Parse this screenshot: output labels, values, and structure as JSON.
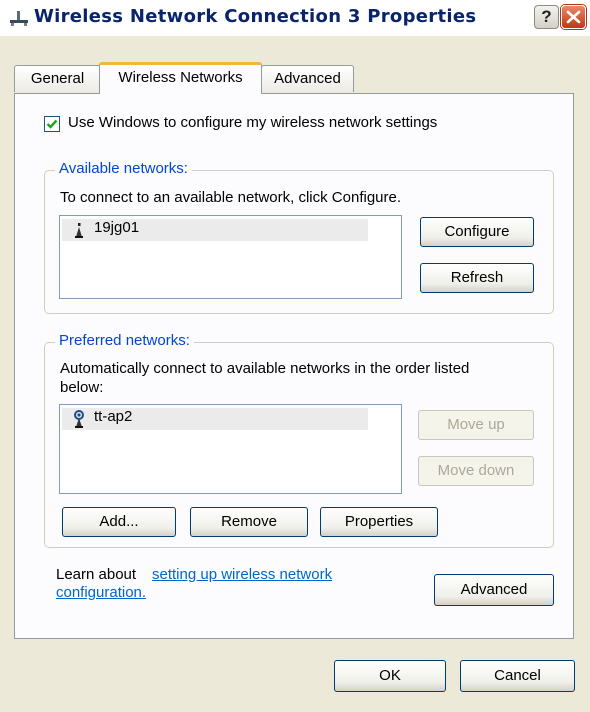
{
  "window": {
    "title": "Wireless Network Connection 3 Properties",
    "help_label": "?",
    "close_label": "Close"
  },
  "tabs": [
    {
      "label": "General",
      "active": false
    },
    {
      "label": "Wireless Networks",
      "active": true
    },
    {
      "label": "Advanced",
      "active": false
    }
  ],
  "use_windows": {
    "label": "Use Windows to configure my wireless network settings",
    "checked": true
  },
  "available": {
    "group_title": "Available networks:",
    "instruction": "To connect to an available network, click Configure.",
    "networks": [
      {
        "name": "19jg01",
        "icon": "wireless-antenna-icon"
      }
    ],
    "configure_label": "Configure",
    "refresh_label": "Refresh"
  },
  "preferred": {
    "group_title": "Preferred networks:",
    "instruction_line1": "Automatically connect to available networks in the order listed",
    "instruction_line2": "below:",
    "networks": [
      {
        "name": "tt-ap2",
        "icon": "wireless-connected-icon"
      }
    ],
    "move_up_label": "Move up",
    "move_down_label": "Move down",
    "add_label": "Add...",
    "remove_label": "Remove",
    "properties_label": "Properties"
  },
  "learn": {
    "prefix": "Learn about ",
    "link_line1": "setting up wireless network",
    "link_line2": "configuration.",
    "advanced_label": "Advanced"
  },
  "footer": {
    "ok_label": "OK",
    "cancel_label": "Cancel"
  },
  "colors": {
    "title_text": "#0a246a",
    "group_title": "#0046d5",
    "tab_highlight": "#f5b43a",
    "link": "#0066cc",
    "close_button": "#c1380f"
  }
}
